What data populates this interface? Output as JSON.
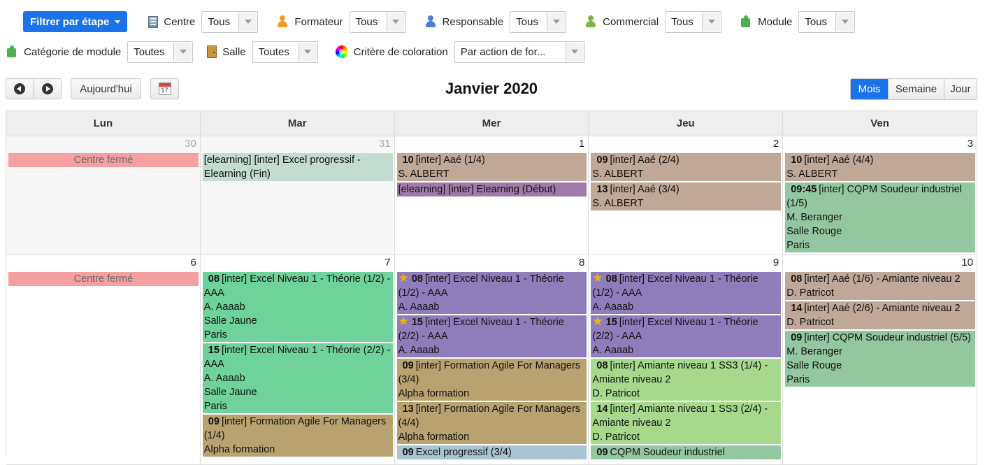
{
  "filters": {
    "stage_button": "Filtrer par étape",
    "row1": [
      {
        "key": "centre",
        "label": "Centre",
        "value": "Tous",
        "icon": "building-icon"
      },
      {
        "key": "formateur",
        "label": "Formateur",
        "value": "Tous",
        "icon": "person-orange-icon"
      },
      {
        "key": "responsable",
        "label": "Responsable",
        "value": "Tous",
        "icon": "person-blue-icon"
      },
      {
        "key": "commercial",
        "label": "Commercial",
        "value": "Tous",
        "icon": "person-green-icon"
      },
      {
        "key": "module",
        "label": "Module",
        "value": "Tous",
        "icon": "puzzle-icon"
      }
    ],
    "row2": [
      {
        "key": "categorie",
        "label": "Catégorie de module",
        "value": "Toutes",
        "icon": "puzzle-icon"
      },
      {
        "key": "salle",
        "label": "Salle",
        "value": "Toutes",
        "icon": "door-icon"
      },
      {
        "key": "coloration",
        "label": "Critère de coloration",
        "value": "Par action de for...",
        "icon": "color-wheel-icon"
      }
    ]
  },
  "toolbar": {
    "today_label": "Aujourd'hui",
    "title": "Janvier 2020",
    "views": [
      "Mois",
      "Semaine",
      "Jour"
    ],
    "active_view": "Mois"
  },
  "calendar": {
    "weekdays": [
      "Lun",
      "Mar",
      "Mer",
      "Jeu",
      "Ven"
    ],
    "weeks": [
      {
        "days": [
          {
            "num": "30",
            "other": true,
            "events": [
              {
                "closed": true,
                "lines": [
                  "Centre fermé"
                ]
              }
            ]
          },
          {
            "num": "31",
            "other": true,
            "events": [
              {
                "color": "#c3dccf",
                "lines": [
                  "[elearning] [inter] Excel progressif - Elearning (Fin)"
                ]
              }
            ]
          },
          {
            "num": "1",
            "events": [
              {
                "color": "#bfa898",
                "time": "10",
                "lines": [
                  "[inter] Aaé (1/4)",
                  "S. ALBERT"
                ]
              },
              {
                "color": "#a07aa8",
                "lines": [
                  "[elearning] [inter] Elearning (Début)"
                ]
              }
            ]
          },
          {
            "num": "2",
            "events": [
              {
                "color": "#bfa898",
                "time": "09",
                "lines": [
                  "[inter] Aaé (2/4)",
                  "S. ALBERT"
                ]
              },
              {
                "color": "#bfa898",
                "time": "13",
                "lines": [
                  "[inter] Aaé (3/4)",
                  "S. ALBERT"
                ]
              }
            ]
          },
          {
            "num": "3",
            "events": [
              {
                "color": "#bfa898",
                "time": "10",
                "lines": [
                  "[inter] Aaé (4/4)",
                  "S. ALBERT"
                ]
              },
              {
                "color": "#93c7a0",
                "time": "09:45",
                "lines": [
                  "[inter] CQPM Soudeur industriel (1/5)",
                  "M. Beranger",
                  "Salle Rouge",
                  "Paris"
                ]
              }
            ]
          }
        ]
      },
      {
        "days": [
          {
            "num": "6",
            "events": [
              {
                "closed": true,
                "lines": [
                  "Centre fermé"
                ]
              }
            ]
          },
          {
            "num": "7",
            "events": [
              {
                "color": "#6ed29a",
                "time": "08",
                "lines": [
                  "[inter] Excel Niveau 1 - Théorie (1/2) - AAA",
                  "A. Aaaab",
                  "Salle Jaune",
                  "Paris"
                ]
              },
              {
                "color": "#6ed29a",
                "time": "15",
                "lines": [
                  "[inter] Excel Niveau 1 - Théorie (2/2) - AAA",
                  "A. Aaaab",
                  "Salle Jaune",
                  "Paris"
                ]
              },
              {
                "color": "#b8a370",
                "time": "09",
                "lines": [
                  "[inter] Formation Agile For Managers (1/4)",
                  "Alpha formation"
                ]
              }
            ]
          },
          {
            "num": "8",
            "events": [
              {
                "color": "#8f7dbb",
                "star": true,
                "time": "08",
                "lines": [
                  "[inter] Excel Niveau 1 - Théorie (1/2) - AAA",
                  "A. Aaaab"
                ]
              },
              {
                "color": "#8f7dbb",
                "star": true,
                "time": "15",
                "lines": [
                  "[inter] Excel Niveau 1 - Théorie (2/2) - AAA",
                  "A. Aaaab"
                ]
              },
              {
                "color": "#b8a370",
                "time": "09",
                "lines": [
                  "[inter] Formation Agile For Managers (3/4)",
                  "Alpha formation"
                ]
              },
              {
                "color": "#b8a370",
                "time": "13",
                "lines": [
                  "[inter] Formation Agile For Managers (4/4)",
                  "Alpha formation"
                ]
              },
              {
                "color": "#a8c4cf",
                "time": "09",
                "lines": [
                  "Excel progressif (3/4)"
                ]
              }
            ]
          },
          {
            "num": "9",
            "events": [
              {
                "color": "#8f7dbb",
                "star": true,
                "time": "08",
                "lines": [
                  "[inter] Excel Niveau 1 - Théorie (1/2) - AAA",
                  "A. Aaaab"
                ]
              },
              {
                "color": "#8f7dbb",
                "star": true,
                "time": "15",
                "lines": [
                  "[inter] Excel Niveau 1 - Théorie (2/2) - AAA",
                  "A. Aaaab"
                ]
              },
              {
                "color": "#a6d98c",
                "time": "08",
                "lines": [
                  "[inter] Amiante niveau 1 SS3 (1/4) - Amiante niveau 2",
                  "D. Patricot"
                ]
              },
              {
                "color": "#a6d98c",
                "time": "14",
                "lines": [
                  "[inter] Amiante niveau 1 SS3 (2/4) - Amiante niveau 2",
                  "D. Patricot"
                ]
              },
              {
                "color": "#93c7a0",
                "time": "09",
                "lines": [
                  "CQPM Soudeur industriel"
                ]
              }
            ]
          },
          {
            "num": "10",
            "events": [
              {
                "color": "#bfa898",
                "time": "08",
                "lines": [
                  "[inter] Aaé (1/6) - Amiante niveau 2",
                  "D. Patricot"
                ]
              },
              {
                "color": "#bfa898",
                "time": "14",
                "lines": [
                  "[inter] Aaé (2/6) - Amiante niveau 2",
                  "D. Patricot"
                ]
              },
              {
                "color": "#93c7a0",
                "time": "09",
                "lines": [
                  "[inter] CQPM Soudeur industriel (5/5)",
                  "M. Beranger",
                  "Salle Rouge",
                  "Paris"
                ]
              }
            ]
          }
        ]
      }
    ]
  }
}
